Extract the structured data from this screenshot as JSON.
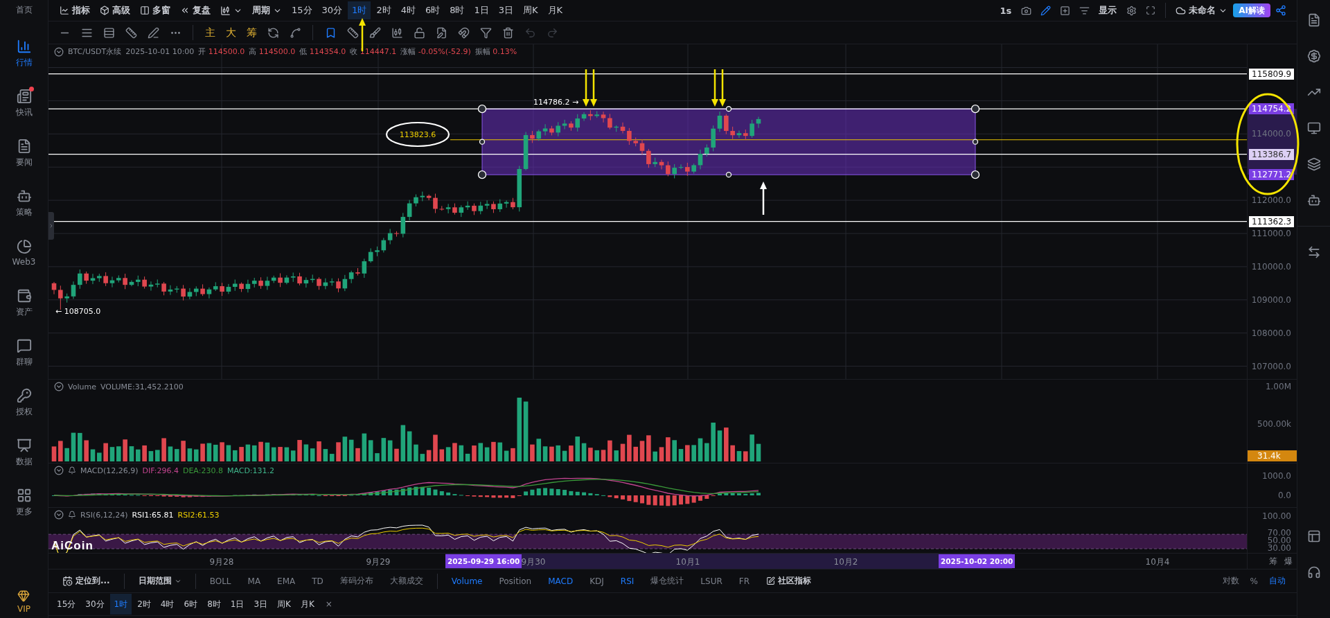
{
  "sidebar": {
    "top_label": "首页",
    "items": [
      {
        "label": "行情",
        "selected": true,
        "dot": false
      },
      {
        "label": "快讯",
        "selected": false,
        "dot": true
      },
      {
        "label": "要闻",
        "selected": false,
        "dot": false
      },
      {
        "label": "策略",
        "selected": false,
        "dot": false
      },
      {
        "label": "Web3",
        "selected": false,
        "dot": false
      },
      {
        "label": "资产",
        "selected": false,
        "dot": false
      },
      {
        "label": "群聊",
        "selected": false,
        "dot": false
      },
      {
        "label": "授权",
        "selected": false,
        "dot": false
      },
      {
        "label": "数据",
        "selected": false,
        "dot": false
      },
      {
        "label": "更多",
        "selected": false,
        "dot": false
      }
    ],
    "vip": "VIP"
  },
  "toolbar": {
    "tools": [
      "指标",
      "高级",
      "多窗",
      "复盘"
    ],
    "period_menu": "周期",
    "intervals": [
      {
        "label": "15分",
        "selected": false
      },
      {
        "label": "30分",
        "selected": false
      },
      {
        "label": "1时",
        "selected": true
      },
      {
        "label": "2时",
        "selected": false
      },
      {
        "label": "4时",
        "selected": false
      },
      {
        "label": "6时",
        "selected": false
      },
      {
        "label": "8时",
        "selected": false
      },
      {
        "label": "1日",
        "selected": false
      },
      {
        "label": "3日",
        "selected": false
      },
      {
        "label": "周K",
        "selected": false
      },
      {
        "label": "月K",
        "selected": false
      }
    ],
    "refresh": "1s",
    "display": "显示",
    "layout_name": "未命名",
    "ai_button": "AI解读"
  },
  "drawing_toolbar": {
    "chart_modes": [
      "主",
      "大",
      "筹"
    ]
  },
  "info": {
    "symbol": "BTC/USDT永续",
    "time": "2025-10-01 10:00",
    "fields": [
      {
        "label": "开",
        "value": "114500.0"
      },
      {
        "label": "高",
        "value": "114500.0"
      },
      {
        "label": "低",
        "value": "114354.0"
      },
      {
        "label": "收",
        "value": "114447.1"
      },
      {
        "label": "涨幅",
        "value": "-0.05%(-52.9)"
      },
      {
        "label": "振幅",
        "value": "0.13%"
      }
    ]
  },
  "main_chart": {
    "price_ticks": [
      "114000.0",
      "112000.0",
      "111000.0",
      "110000.0",
      "109000.0",
      "108000.0",
      "107000.0"
    ],
    "price_tags": [
      {
        "label": "115809.9",
        "kind": "line"
      },
      {
        "label": "114754.2",
        "kind": "line_box"
      },
      {
        "label": "113386.7",
        "kind": "line_band"
      },
      {
        "label": "112771.2",
        "kind": "box"
      },
      {
        "label": "111362.3",
        "kind": "line"
      }
    ],
    "midline_label": "113823.6",
    "high_marker": "114786.2 →",
    "low_marker": "← 108705.0"
  },
  "volume": {
    "legend": "Volume",
    "value": "VOLUME:31,452.2100",
    "ticks": [
      "1.00M",
      "500.00k"
    ],
    "tag": "31.4k"
  },
  "macd": {
    "legend": "MACD(12,26,9)",
    "values": [
      {
        "text": "DIF:296.4",
        "color": "#c2458f"
      },
      {
        "text": "DEA:230.8",
        "color": "#3a9a3a"
      },
      {
        "text": "MACD:131.2",
        "color": "#3fb68b"
      }
    ],
    "ticks": [
      "1000.0",
      "0.0"
    ]
  },
  "rsi": {
    "legend": "RSI(6,12,24)",
    "values": [
      {
        "text": "RSI1:65.81",
        "color": "#ffffff"
      },
      {
        "text": "RSI2:61.53",
        "color": "#f0d000"
      }
    ],
    "ticks": [
      "100.00",
      "70.00",
      "50.00",
      "30.00"
    ],
    "logo": "AiCoin"
  },
  "time_axis": {
    "labels": [
      "9月28",
      "9月29",
      "9月30",
      "10月1",
      "10月2",
      "10月4"
    ],
    "range_start": "2025-09-29 16:00",
    "range_end": "2025-10-02 20:00",
    "right_buttons": [
      "筹",
      "爆"
    ]
  },
  "indicator_bar": {
    "locate": "定位到...",
    "date_range": "日期范围",
    "overlays": [
      "BOLL",
      "MA",
      "EMA",
      "TD",
      "筹码分布",
      "大额成交"
    ],
    "panes": [
      {
        "label": "Volume",
        "on": true
      },
      {
        "label": "Position",
        "on": false
      },
      {
        "label": "MACD",
        "on": true
      },
      {
        "label": "KDJ",
        "on": false
      },
      {
        "label": "RSI",
        "on": true
      },
      {
        "label": "爆仓统计",
        "on": false
      },
      {
        "label": "LSUR",
        "on": false
      },
      {
        "label": "FR",
        "on": false
      }
    ],
    "community": "社区指标",
    "scale_options": [
      {
        "label": "对数",
        "on": false
      },
      {
        "label": "%",
        "on": false
      },
      {
        "label": "自动",
        "on": true
      }
    ]
  },
  "bottom_intervals": [
    {
      "label": "15分",
      "selected": false
    },
    {
      "label": "30分",
      "selected": false
    },
    {
      "label": "1时",
      "selected": true
    },
    {
      "label": "2时",
      "selected": false
    },
    {
      "label": "4时",
      "selected": false
    },
    {
      "label": "6时",
      "selected": false
    },
    {
      "label": "8时",
      "selected": false
    },
    {
      "label": "1日",
      "selected": false
    },
    {
      "label": "3日",
      "selected": false
    },
    {
      "label": "周K",
      "selected": false
    },
    {
      "label": "月K",
      "selected": false
    }
  ],
  "bottom_close": "×"
}
